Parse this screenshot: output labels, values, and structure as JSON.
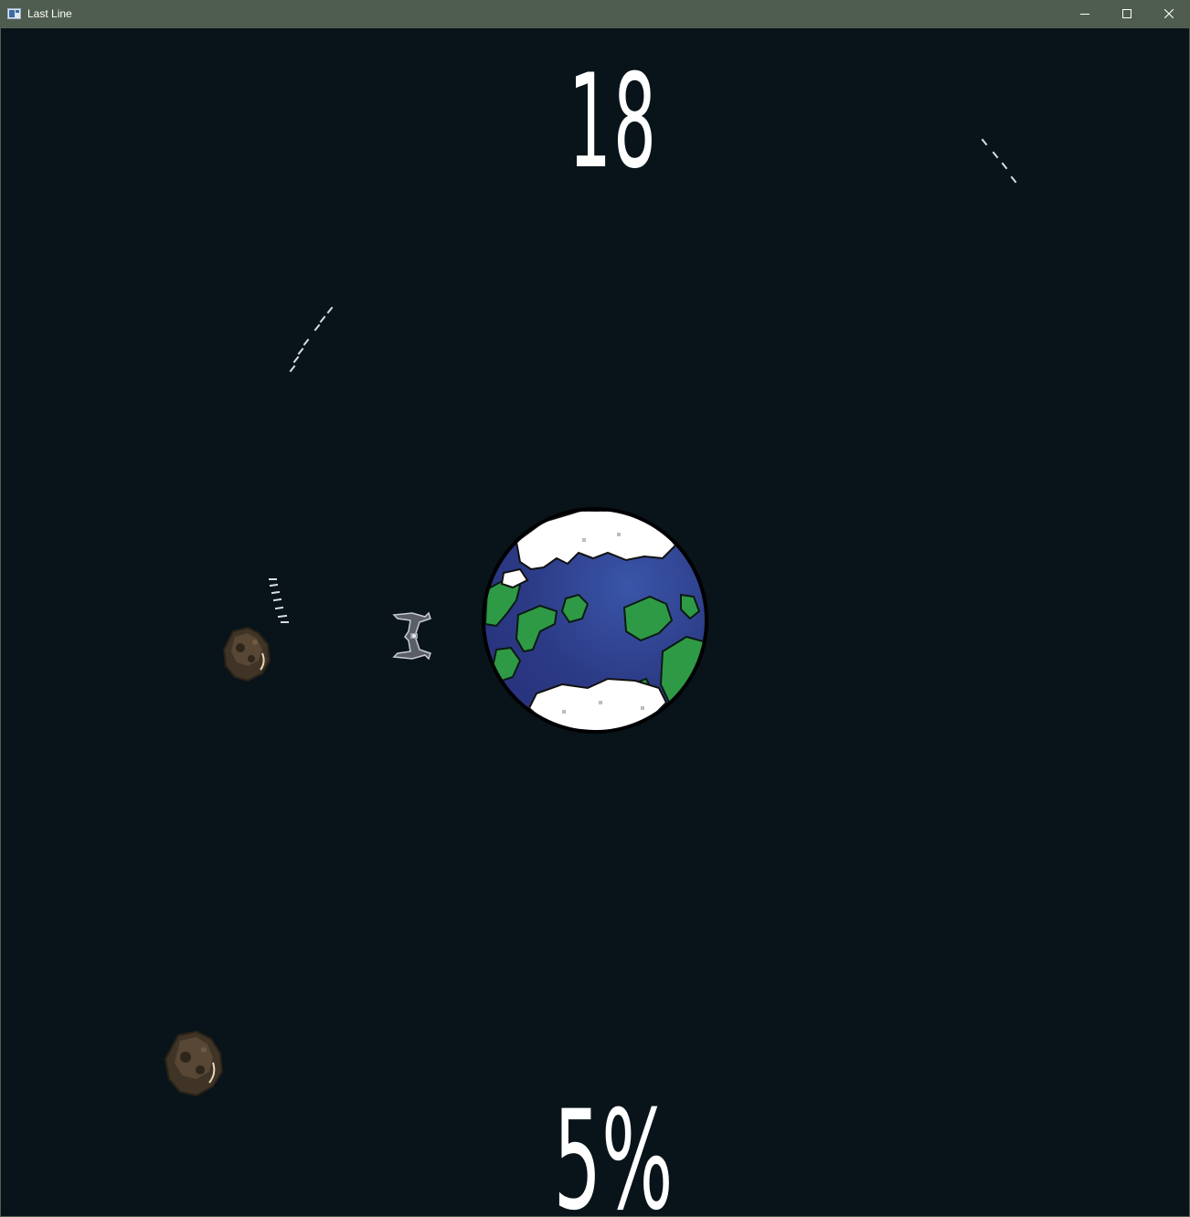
{
  "window": {
    "title": "Last Line",
    "controls": {
      "minimize_icon": "minimize-icon",
      "maximize_icon": "maximize-icon",
      "close_icon": "close-icon"
    }
  },
  "hud": {
    "score": "18",
    "planet_damage": "5%"
  },
  "colors": {
    "space": "#08141a",
    "titlebar": "#4f5d50",
    "ocean": "#2c3b86",
    "land": "#2f9a45",
    "ice": "#ffffff",
    "asteroid": "#4a3d2e"
  },
  "sprites": {
    "planet": "earth-planet",
    "ship": "defender-ship",
    "asteroids": [
      "asteroid",
      "asteroid"
    ],
    "projectile_trails": [
      "bullet-trail",
      "bullet-trail",
      "bullet-trail"
    ]
  }
}
